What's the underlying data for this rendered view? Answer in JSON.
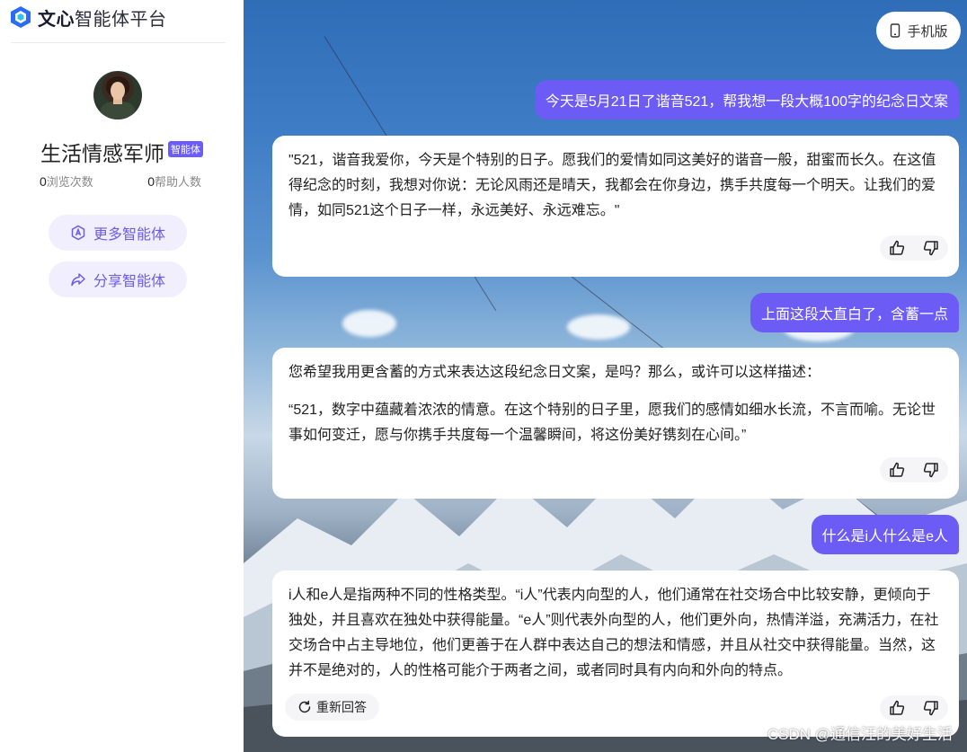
{
  "brand": {
    "name_bold": "文心",
    "name_rest": "智能体平台"
  },
  "agent": {
    "name": "生活情感军师",
    "badge": "智能体"
  },
  "stats": {
    "views_count": "0",
    "views_label": "浏览次数",
    "helped_count": "0",
    "helped_label": "帮助人数"
  },
  "sidebar_buttons": {
    "more": "更多智能体",
    "share": "分享智能体"
  },
  "header": {
    "mobile": "手机版"
  },
  "messages": [
    {
      "role": "user",
      "text": "今天是5月21日了谐音521，帮我想一段大概100字的纪念日文案"
    },
    {
      "role": "bot",
      "paragraphs": [
        "\"521，谐音我爱你，今天是个特别的日子。愿我们的爱情如同这美好的谐音一般，甜蜜而长久。在这值得纪念的时刻，我想对你说：无论风雨还是晴天，我都会在你身边，携手共度每一个明天。让我们的爱情，如同521这个日子一样，永远美好、永远难忘。\""
      ]
    },
    {
      "role": "user",
      "text": "上面这段太直白了，含蓄一点"
    },
    {
      "role": "bot",
      "paragraphs": [
        "您希望我用更含蓄的方式来表达这段纪念日文案，是吗？那么，或许可以这样描述：",
        "“521，数字中蕴藏着浓浓的情意。在这个特别的日子里，愿我们的感情如细水长流，不言而喻。无论世事如何变迁，愿与你携手共度每一个温馨瞬间，将这份美好镌刻在心间。”"
      ]
    },
    {
      "role": "user",
      "text": "什么是i人什么是e人"
    },
    {
      "role": "bot",
      "paragraphs": [
        "i人和e人是指两种不同的性格类型。“i人”代表内向型的人，他们通常在社交场合中比较安静，更倾向于独处，并且喜欢在独处中获得能量。“e人”则代表外向型的人，他们更外向，热情洋溢，充满活力，在社交场合中占主导地位，他们更善于在人群中表达自己的想法和情感，并且从社交中获得能量。当然，这并不是绝对的，人的性格可能介于两者之间，或者同时具有内向和外向的特点。"
      ]
    }
  ],
  "actions": {
    "regenerate": "重新回答"
  },
  "watermark": "CSDN @通信汪的美好生活",
  "colors": {
    "accent": "#6c5bf5",
    "badge": "#6a5cff",
    "button_bg": "#f1effd"
  },
  "icons": {
    "logo": "wenxin-logo-icon",
    "more": "agent-icon",
    "share": "share-icon",
    "mobile": "phone-icon",
    "like": "thumbs-up-icon",
    "dislike": "thumbs-down-icon",
    "regenerate": "refresh-icon"
  }
}
